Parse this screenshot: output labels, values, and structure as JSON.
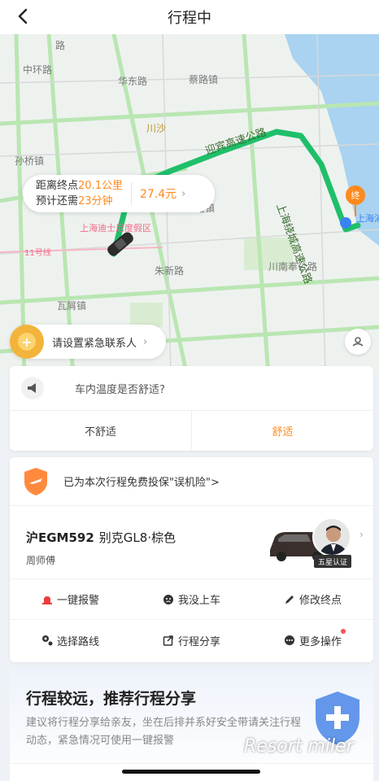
{
  "header": {
    "title": "行程中"
  },
  "map": {
    "labels": {
      "road1": "华东路",
      "town1": "蔡路镇",
      "town2": "川沙",
      "town3": "孙桥镇",
      "town4": "瓦屑镇",
      "town5": "路镇",
      "expressway": "迎宾高速公路",
      "highway": "上海绕城高速公路",
      "road2": "川南奉公路",
      "road3": "朱新路",
      "poi_disney": "上海迪士尼度假区",
      "poi_airport": "上海浦东国际机场",
      "metro": "11号线",
      "end_marker": "终",
      "road_left": "中环路",
      "road_top": "路"
    },
    "colors": {
      "route": "#1fbf6a",
      "road": "#b9e6b2",
      "water": "#a9d3f0",
      "end": "#ff8a1f"
    }
  },
  "eta": {
    "distance_prefix": "距离终点",
    "distance_value": "20.1公里",
    "time_prefix": "预计还需",
    "time_value": "23分钟",
    "price": "27.4元"
  },
  "emergency": {
    "label": "请设置紧急联系人"
  },
  "survey": {
    "question": "车内温度是否舒适?",
    "option_bad": "不舒适",
    "option_good": "舒适"
  },
  "driver_card": {
    "insurance_text": "已为本次行程免费投保\"误机险\">",
    "plate": "沪EGM592",
    "car_model": "别克GL8·棕色",
    "driver_name": "周师傅",
    "badge": "五星认证",
    "actions": [
      {
        "label": "一键报警",
        "icon": "alarm-icon"
      },
      {
        "label": "我没上车",
        "icon": "sad-face-icon"
      },
      {
        "label": "修改终点",
        "icon": "pencil-icon"
      },
      {
        "label": "选择路线",
        "icon": "route-icon"
      },
      {
        "label": "行程分享",
        "icon": "share-icon"
      },
      {
        "label": "更多操作",
        "icon": "more-icon"
      }
    ]
  },
  "promo": {
    "title": "行程较远，推荐行程分享",
    "description": "建议将行程分享给亲友，坐在后排并系好安全带请关注行程动态，紧急情况可使用一键报警"
  },
  "watermark": "Resort miler"
}
